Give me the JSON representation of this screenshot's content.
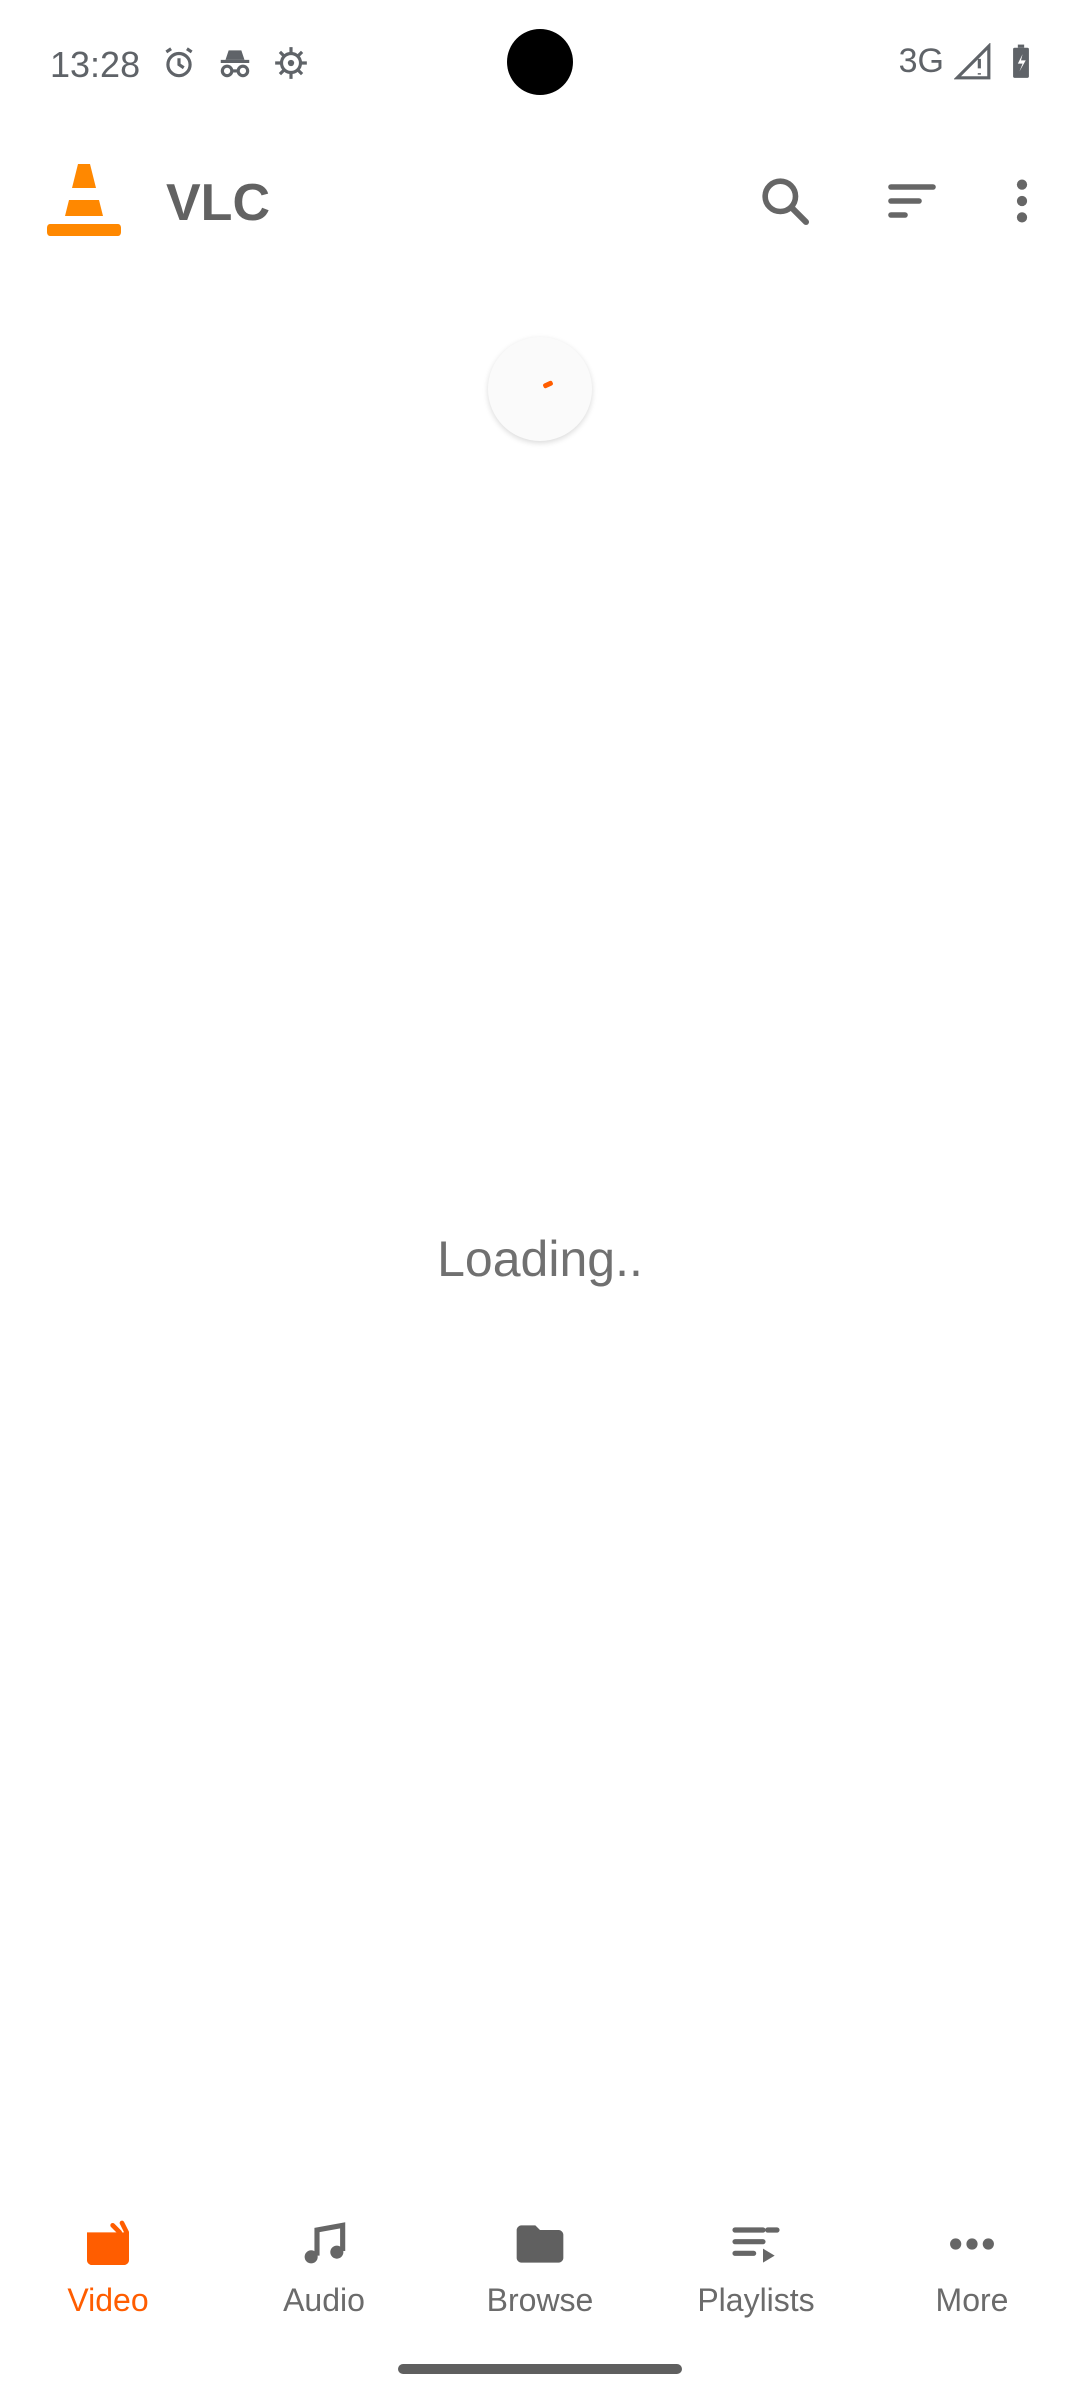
{
  "status_bar": {
    "time": "13:28",
    "network": "3G",
    "icons": [
      "alarm-icon",
      "incognito-icon",
      "settings-icon",
      "signal-icon",
      "battery-charging-icon"
    ]
  },
  "app_bar": {
    "title": "VLC",
    "actions": [
      "search-icon",
      "sort-icon",
      "more-vert-icon"
    ]
  },
  "main": {
    "loading_text": "Loading.."
  },
  "bottom_nav": {
    "items": [
      {
        "label": "Video",
        "icon": "video-icon",
        "active": true
      },
      {
        "label": "Audio",
        "icon": "audio-icon",
        "active": false
      },
      {
        "label": "Browse",
        "icon": "folder-icon",
        "active": false
      },
      {
        "label": "Playlists",
        "icon": "playlist-icon",
        "active": false
      },
      {
        "label": "More",
        "icon": "more-horiz-icon",
        "active": false
      }
    ]
  },
  "colors": {
    "accent": "#ff5d00",
    "text": "#606060",
    "background": "#ffffff"
  }
}
